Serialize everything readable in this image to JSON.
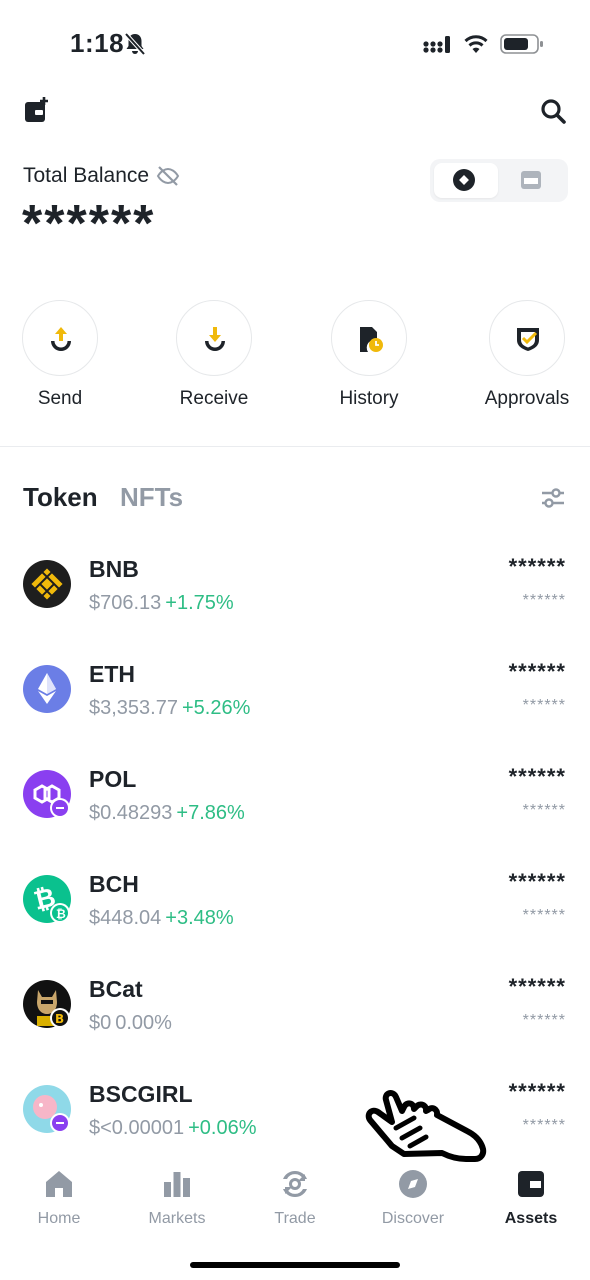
{
  "status_bar": {
    "time": "1:18",
    "icons": [
      "bell-off-icon",
      "signal-icon",
      "wifi-icon",
      "battery-icon"
    ]
  },
  "header": {
    "left_icon": "wallet-add-icon",
    "right_icon": "search-icon",
    "total_balance_label": "Total Balance",
    "balance_hidden": "******",
    "view_toggle": [
      "token-view-icon",
      "wallet-view-icon"
    ]
  },
  "actions": [
    {
      "label": "Send",
      "icon": "send-icon"
    },
    {
      "label": "Receive",
      "icon": "receive-icon"
    },
    {
      "label": "History",
      "icon": "history-icon"
    },
    {
      "label": "Approvals",
      "icon": "approvals-icon"
    }
  ],
  "tabs": {
    "token": "Token",
    "nfts": "NFTs",
    "active": "Token"
  },
  "tokens": [
    {
      "symbol": "BNB",
      "price": "$706.13",
      "change": "+1.75%",
      "amount": "******",
      "value": "******"
    },
    {
      "symbol": "ETH",
      "price": "$3,353.77",
      "change": "+5.26%",
      "amount": "******",
      "value": "******"
    },
    {
      "symbol": "POL",
      "price": "$0.48293",
      "change": "+7.86%",
      "amount": "******",
      "value": "******"
    },
    {
      "symbol": "BCH",
      "price": "$448.04",
      "change": "+3.48%",
      "amount": "******",
      "value": "******"
    },
    {
      "symbol": "BCat",
      "price": "$0",
      "change": "0.00%",
      "amount": "******",
      "value": "******"
    },
    {
      "symbol": "BSCGIRL",
      "price": "$<0.00001",
      "change": "+0.06%",
      "amount": "******",
      "value": "******"
    }
  ],
  "colors": {
    "positive": "#2ebd85",
    "neutral": "#929aa5",
    "accent": "#f0b90b",
    "text": "#1e2329"
  },
  "bottom_nav": [
    {
      "label": "Home",
      "icon": "home-icon"
    },
    {
      "label": "Markets",
      "icon": "markets-icon"
    },
    {
      "label": "Trade",
      "icon": "trade-icon"
    },
    {
      "label": "Discover",
      "icon": "discover-icon"
    },
    {
      "label": "Assets",
      "icon": "assets-icon",
      "active": true
    }
  ]
}
